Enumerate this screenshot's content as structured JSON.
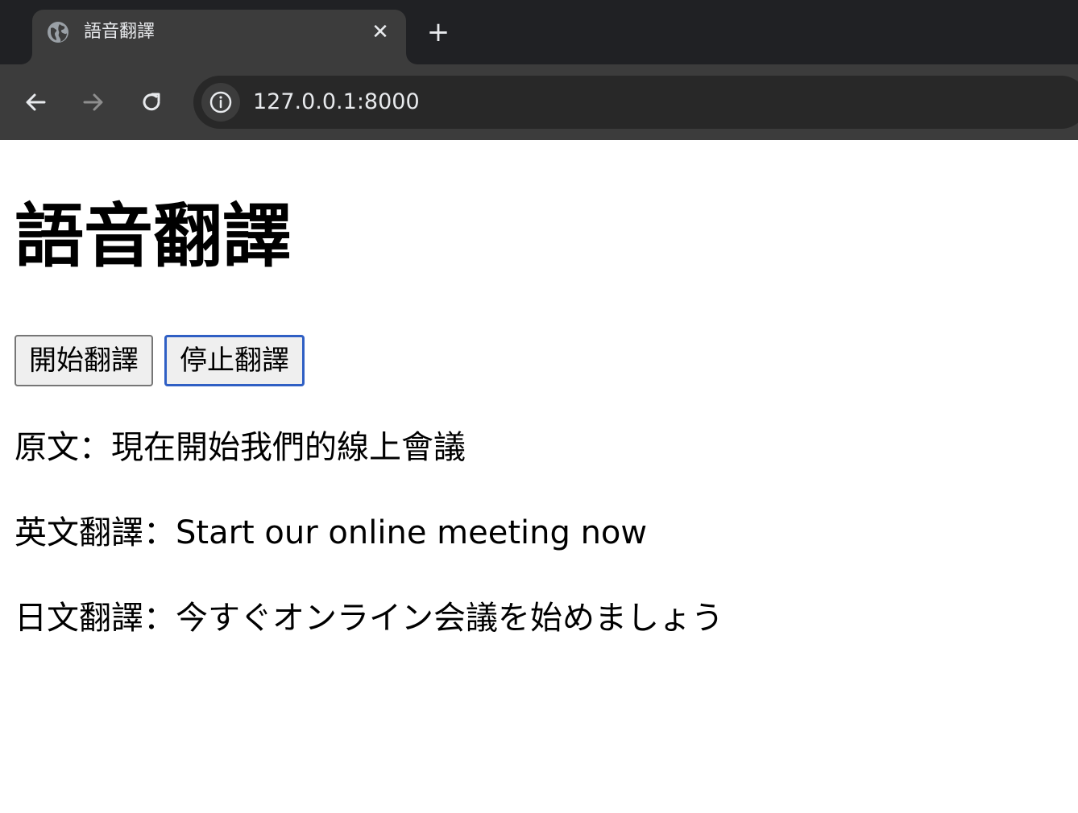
{
  "browser": {
    "tab": {
      "title": "語音翻譯",
      "close_glyph": "✕",
      "favicon_icon": "globe-icon"
    },
    "new_tab_glyph": "+",
    "nav": {
      "back_icon": "arrow-left-icon",
      "forward_icon": "arrow-right-icon",
      "reload_icon": "reload-icon"
    },
    "address_bar": {
      "url": "127.0.0.1:8000",
      "site_info_icon": "info-icon"
    },
    "colors": {
      "tabstrip": "#202124",
      "toolbar": "#3c3c3c",
      "omnibox": "#282828",
      "text": "#e8eaed"
    }
  },
  "page": {
    "title": "語音翻譯",
    "buttons": {
      "start_label": "開始翻譯",
      "stop_label": "停止翻譯"
    },
    "original_text": "原文：現在開始我們的線上會議",
    "english_translation": "英文翻譯：Start our online meeting now",
    "japanese_translation": "日文翻譯：今すぐオンライン会議を始めましょう",
    "colors": {
      "focus_ring": "#2f5fc4"
    }
  }
}
